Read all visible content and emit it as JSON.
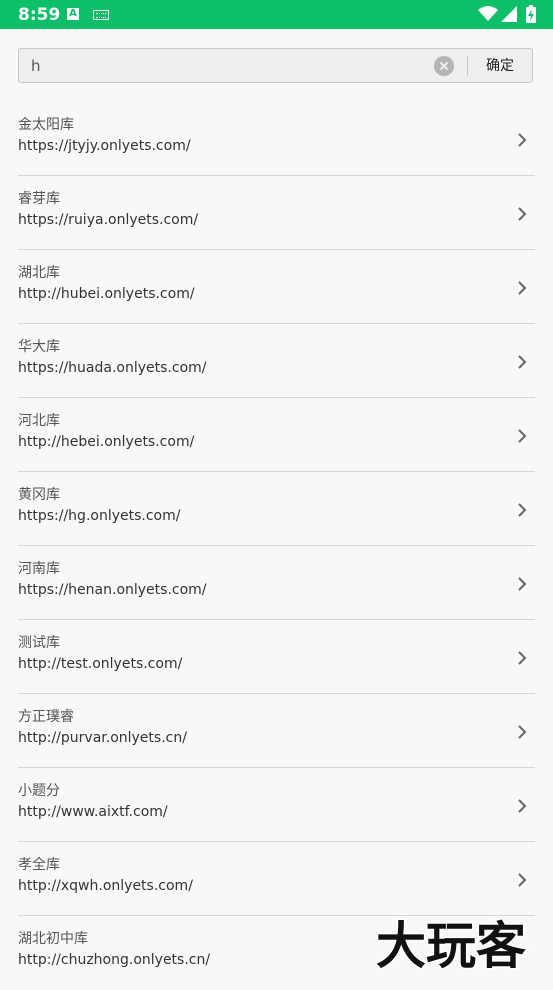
{
  "status": {
    "time": "8:59",
    "notif_icon": "A"
  },
  "search": {
    "value": "h",
    "confirm_label": "确定"
  },
  "items": [
    {
      "name": "金太阳库",
      "url": "https://jtyjy.onlyets.com/"
    },
    {
      "name": "睿芽库",
      "url": "https://ruiya.onlyets.com/"
    },
    {
      "name": "湖北库",
      "url": "http://hubei.onlyets.com/"
    },
    {
      "name": "华大库",
      "url": "https://huada.onlyets.com/"
    },
    {
      "name": "河北库",
      "url": "http://hebei.onlyets.com/"
    },
    {
      "name": "黄冈库",
      "url": "https://hg.onlyets.com/"
    },
    {
      "name": "河南库",
      "url": "https://henan.onlyets.com/"
    },
    {
      "name": "测试库",
      "url": "http://test.onlyets.com/"
    },
    {
      "name": "方正璞睿",
      "url": "http://purvar.onlyets.cn/"
    },
    {
      "name": "小题分",
      "url": "http://www.aixtf.com/"
    },
    {
      "name": "孝全库",
      "url": "http://xqwh.onlyets.com/"
    },
    {
      "name": "湖北初中库",
      "url": "http://chuzhong.onlyets.cn/"
    }
  ],
  "watermark": "大玩客",
  "colors": {
    "status_bar": "#0dbf68"
  }
}
